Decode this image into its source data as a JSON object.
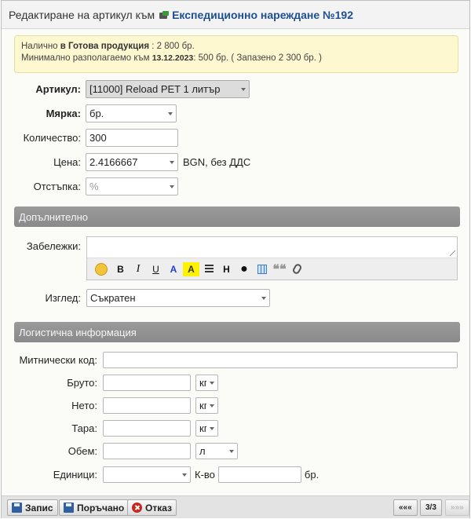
{
  "title": {
    "prefix": "Редактиране на артикул към",
    "document": "Експедиционно нареждане №192"
  },
  "info": {
    "line1_prefix": "Налично",
    "line1_store": "в Готова продукция",
    "line1_value": ": 2 800 бр.",
    "line2_prefix": "Минимално разполагаемо към",
    "line2_date": "13.12.2023",
    "line2_value": ": 500 бр. ( Запазено 2 300 бр. )"
  },
  "form": {
    "article_label": "Артикул",
    "article_value": "[11000] Reload PET 1 литър",
    "measure_label": "Мярка",
    "measure_value": "бр.",
    "quantity_label": "Количество:",
    "quantity_value": "300",
    "price_label": "Цена:",
    "price_value": "2.4166667",
    "price_suffix": "BGN, без ДДС",
    "discount_label": "Отстъпка:",
    "discount_value": "%"
  },
  "additional": {
    "header": "Допълнително",
    "notes_label": "Забележки:",
    "toolbar": {
      "bold": "B",
      "italic": "I",
      "underline": "U",
      "color": "A",
      "highlight": "A",
      "heading": "H",
      "bullet": "●",
      "quote": "❝❝"
    },
    "view_label": "Изглед:",
    "view_value": "Съкратен"
  },
  "logistics": {
    "header": "Логистична информация",
    "customs_label": "Митнически код:",
    "customs_value": "",
    "gross_label": "Бруто:",
    "gross_unit": "кг",
    "net_label": "Нето:",
    "net_unit": "кг",
    "tare_label": "Тара:",
    "tare_unit": "кг",
    "volume_label": "Обем:",
    "volume_unit": "л",
    "units_label": "Единици:",
    "units_value": "",
    "qty_label": "К-во",
    "qty_unit": "бр."
  },
  "footer": {
    "save": "Запис",
    "ordered": "Поръчано",
    "cancel": "Отказ",
    "first": "«««",
    "page": "3/3",
    "last": "»»»"
  }
}
